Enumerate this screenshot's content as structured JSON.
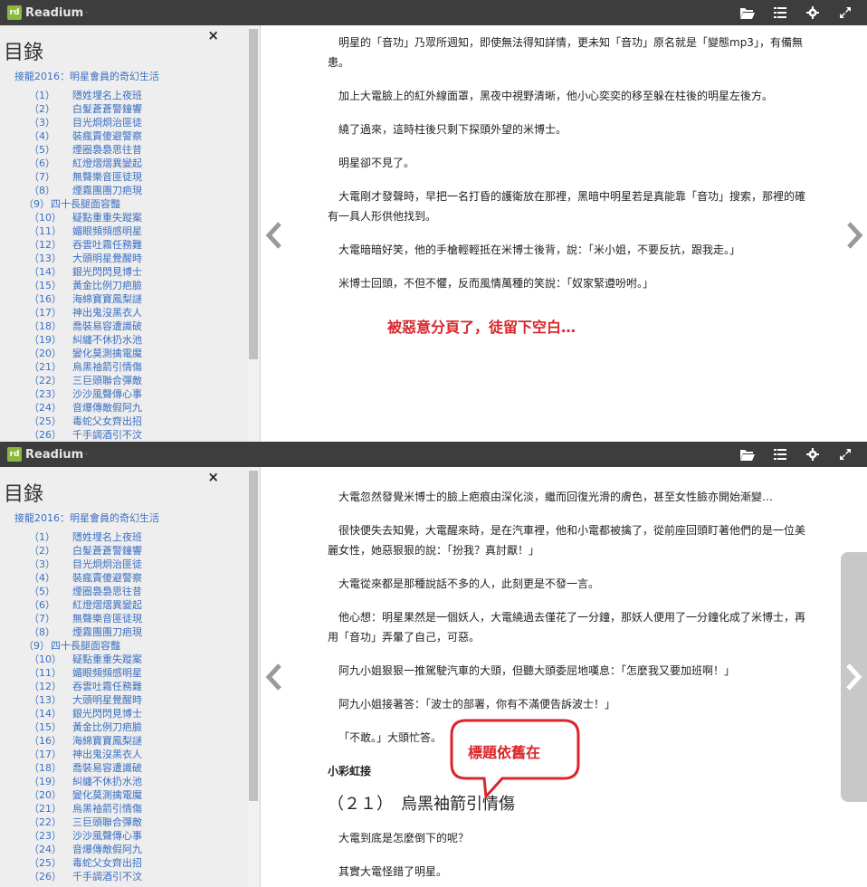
{
  "app": {
    "name": "Readium"
  },
  "toc": {
    "title": "目錄",
    "book_title": "接龍2016：明星會員的奇幻生活",
    "close_label": "×",
    "items": [
      {
        "num": "（1）",
        "title": "隱姓埋名上夜班"
      },
      {
        "num": "（2）",
        "title": "白髮蒼蒼警鐘響"
      },
      {
        "num": "（3）",
        "title": "目光炯炯治匪徒"
      },
      {
        "num": "（4）",
        "title": "裝瘋賣傻避警察"
      },
      {
        "num": "（5）",
        "title": "煙圈裊裊思往昔"
      },
      {
        "num": "（6）",
        "title": "紅燈熠熠異變起"
      },
      {
        "num": "（7）",
        "title": "無聲樂音匪徒現"
      },
      {
        "num": "（8）",
        "title": "煙霧團團刀疤現"
      },
      {
        "num": "（9）",
        "title": "四十長腿面容豔"
      },
      {
        "num": "（10）",
        "title": "疑點重重失蹤案"
      },
      {
        "num": "（11）",
        "title": "媚眼頻頻感明星"
      },
      {
        "num": "（12）",
        "title": "吞雲吐霧任務難"
      },
      {
        "num": "（13）",
        "title": "大頭明星覺醒時"
      },
      {
        "num": "（14）",
        "title": "銀光閃閃見博士"
      },
      {
        "num": "（15）",
        "title": "黃金比例刀疤臉"
      },
      {
        "num": "（16）",
        "title": "海綿寶寶鳳梨謎"
      },
      {
        "num": "（17）",
        "title": "神出鬼沒黑衣人"
      },
      {
        "num": "（18）",
        "title": "喬裝易容遭識破"
      },
      {
        "num": "（19）",
        "title": "糾纏不休扔水池"
      },
      {
        "num": "（20）",
        "title": "變化莫測擒電魔"
      },
      {
        "num": "（21）",
        "title": "烏黑袖箭引情傷"
      },
      {
        "num": "（22）",
        "title": "三巨頭聯合彈敵"
      },
      {
        "num": "（23）",
        "title": "沙沙風聲傳心事"
      },
      {
        "num": "（24）",
        "title": "音爆傳敵假阿九"
      },
      {
        "num": "（25）",
        "title": "毒蛇父女齊出招"
      },
      {
        "num": "（26）",
        "title": "千手調酒引不汶"
      }
    ]
  },
  "top_page": {
    "paragraphs": [
      "明星的「音功」乃眾所週知，即使無法得知詳情，更未知「音功」原名就是「變態mp3」，有備無患。",
      "加上大電臉上的紅外線面罩，黑夜中視野清晰，他小心奕奕的移至躲在柱後的明星左後方。",
      "繞了過來，這時柱後只剩下探頭外望的米博士。",
      "明星卻不見了。",
      "大電剛才發聲時，早把一名打昏的護衛放在那裡，黑暗中明星若是真能靠「音功」搜索，那裡的確有一具人形供他找到。",
      "大電暗暗好笑，他的手槍輕輕抵在米博士後背，說：「米小姐，不要反抗，跟我走。」",
      "米博士回頭，不但不懼，反而風情萬種的笑說：「奴家緊遵吩咐。」"
    ],
    "annotation": "被惡意分頁了，徒留下空白…"
  },
  "bottom_page": {
    "paragraphs": [
      "大電忽然發覺米博士的臉上疤痕由深化淡，繼而回復光滑的膚色，甚至女性臉亦開始漸變…",
      "很快便失去知覺，大電醒來時，是在汽車裡，他和小電都被擒了，從前座回頭盯著他們的是一位美麗女性，她惡狠狠的說：「扮我？真討厭！」",
      "大電從來都是那種說話不多的人，此刻更是不發一言。",
      "他心想：明星果然是一個妖人，大電繞過去僅花了一分鐘，那妖人便用了一分鐘化成了米博士，再用「音功」弄暈了自己，可惡。",
      "阿九小姐狠狠一推駕駛汽車的大頭，但聽大頭委屈地嘆息：「怎麼我又要加班啊！」",
      "阿九小姐接著答：「波士的部署，你有不滿便告訴波士！」",
      "「不敢。」大頭忙答。"
    ],
    "chapter_sub": "小彩虹接",
    "chapter_title": "（２１）　烏黑袖箭引情傷",
    "after": [
      "大電到底是怎麼倒下的呢？",
      "其實大電怪錯了明星。"
    ],
    "annotation": "標題依舊在"
  },
  "colors": {
    "navbar": "#3d3d3d",
    "accent_link": "#3b6fc2",
    "annotation_red": "#d9252b",
    "logo_green": "#8bb93b"
  },
  "icons": [
    "library-icon",
    "toc-icon",
    "settings-icon",
    "fullscreen-icon",
    "prev-page-icon",
    "next-page-icon",
    "close-icon"
  ]
}
